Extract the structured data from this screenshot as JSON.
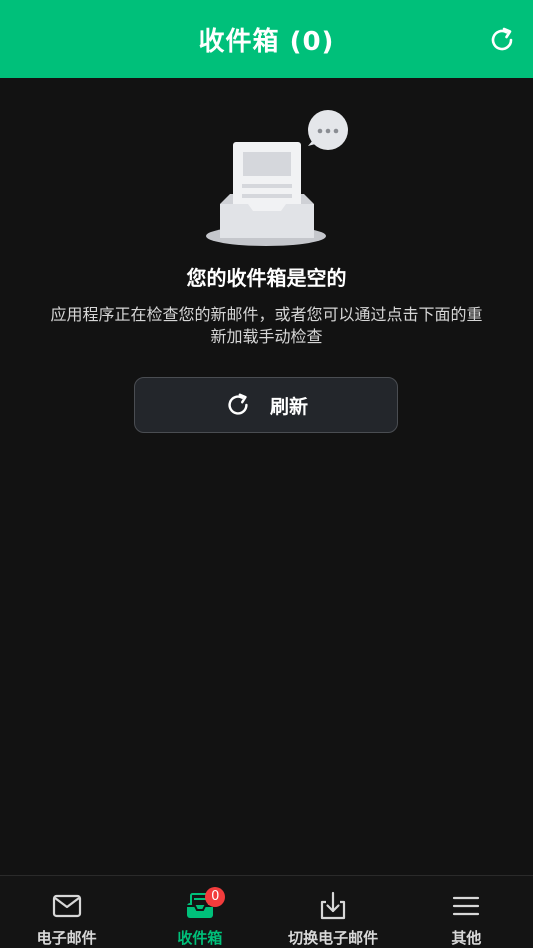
{
  "header": {
    "title": "收件箱 (0)"
  },
  "empty_state": {
    "title": "您的收件箱是空的",
    "description": "应用程序正在检查您的新邮件，或者您可以通过点击下面的重新加载手动检查",
    "refresh_label": "刷新"
  },
  "bottom_nav": {
    "items": [
      {
        "label": "电子邮件",
        "icon": "mail-icon"
      },
      {
        "label": "收件箱",
        "icon": "inbox-icon",
        "badge": "0",
        "active": true
      },
      {
        "label": "切换电子邮件",
        "icon": "download-icon"
      },
      {
        "label": "其他",
        "icon": "menu-icon"
      }
    ]
  },
  "colors": {
    "accent": "#00c07a",
    "background": "#121212",
    "badge": "#f23c3c"
  }
}
